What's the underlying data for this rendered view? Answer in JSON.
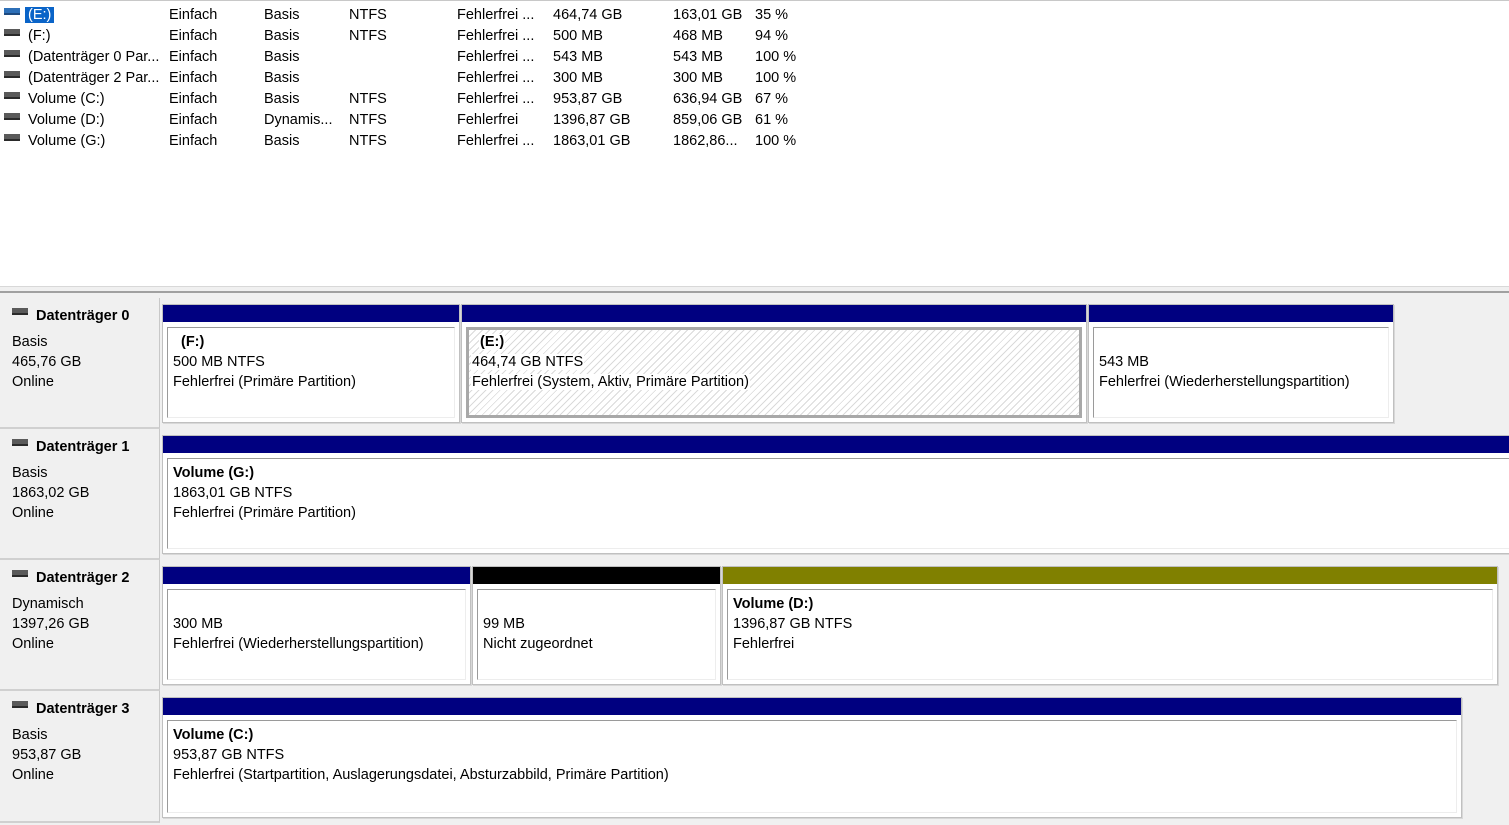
{
  "colors": {
    "primary_partition": "#000080",
    "unallocated": "#000000",
    "simple_dynamic_volume": "#808000",
    "selection": "#0a64c8"
  },
  "volumes": [
    {
      "name": "(E:)",
      "layout": "Einfach",
      "type": "Basis",
      "fs": "NTFS",
      "status": "Fehlerfrei ...",
      "capacity": "464,74 GB",
      "free": "163,01 GB",
      "pct": "35 %",
      "icon": "drive-icon",
      "selected": true
    },
    {
      "name": "(F:)",
      "layout": "Einfach",
      "type": "Basis",
      "fs": "NTFS",
      "status": "Fehlerfrei ...",
      "capacity": "500 MB",
      "free": "468 MB",
      "pct": "94 %",
      "icon": "drive-icon"
    },
    {
      "name": "(Datenträger 0 Par...",
      "layout": "Einfach",
      "type": "Basis",
      "fs": "",
      "status": "Fehlerfrei ...",
      "capacity": "543 MB",
      "free": "543 MB",
      "pct": "100 %",
      "icon": "drive-icon"
    },
    {
      "name": "(Datenträger 2 Par...",
      "layout": "Einfach",
      "type": "Basis",
      "fs": "",
      "status": "Fehlerfrei ...",
      "capacity": "300 MB",
      "free": "300 MB",
      "pct": "100 %",
      "icon": "drive-icon"
    },
    {
      "name": "Volume (C:)",
      "layout": "Einfach",
      "type": "Basis",
      "fs": "NTFS",
      "status": "Fehlerfrei ...",
      "capacity": "953,87 GB",
      "free": "636,94 GB",
      "pct": "67 %",
      "icon": "drive-icon"
    },
    {
      "name": "Volume (D:)",
      "layout": "Einfach",
      "type": "Dynamis...",
      "fs": "NTFS",
      "status": "Fehlerfrei",
      "capacity": "1396,87 GB",
      "free": "859,06 GB",
      "pct": "61 %",
      "icon": "drive-icon"
    },
    {
      "name": "Volume (G:)",
      "layout": "Einfach",
      "type": "Basis",
      "fs": "NTFS",
      "status": "Fehlerfrei ...",
      "capacity": "1863,01 GB",
      "free": "1862,86...",
      "pct": "100 %",
      "icon": "drive-icon"
    }
  ],
  "disks": [
    {
      "title": "Datenträger 0",
      "type": "Basis",
      "size": "465,76 GB",
      "state": "Online",
      "icon": "disk-icon",
      "partitions": [
        {
          "name": "(F:)",
          "size": "500 MB NTFS",
          "status": "Fehlerfrei (Primäre Partition)",
          "color": "#000080"
        },
        {
          "name": "(E:)",
          "size": "464,74 GB NTFS",
          "status": "Fehlerfrei (System, Aktiv, Primäre Partition)",
          "color": "#000080",
          "selected": true
        },
        {
          "name": "",
          "size": "543 MB",
          "status": "Fehlerfrei (Wiederherstellungspartition)",
          "color": "#000080"
        }
      ]
    },
    {
      "title": "Datenträger 1",
      "type": "Basis",
      "size": "1863,02 GB",
      "state": "Online",
      "icon": "disk-icon",
      "partitions": [
        {
          "name": "Volume  (G:)",
          "size": "1863,01 GB NTFS",
          "status": "Fehlerfrei (Primäre Partition)",
          "color": "#000080"
        }
      ]
    },
    {
      "title": "Datenträger 2",
      "type": "Dynamisch",
      "size": "1397,26 GB",
      "state": "Online",
      "icon": "disk-icon",
      "partitions": [
        {
          "name": "",
          "size": "300 MB",
          "status": "Fehlerfrei (Wiederherstellungspartition)",
          "color": "#000080"
        },
        {
          "name": "",
          "size": "99 MB",
          "status": "Nicht zugeordnet",
          "color": "#000000"
        },
        {
          "name": "Volume  (D:)",
          "size": "1396,87 GB NTFS",
          "status": "Fehlerfrei",
          "color": "#808000"
        }
      ]
    },
    {
      "title": "Datenträger 3",
      "type": "Basis",
      "size": "953,87 GB",
      "state": "Online",
      "icon": "disk-icon",
      "partitions": [
        {
          "name": "Volume  (C:)",
          "size": "953,87 GB NTFS",
          "status": "Fehlerfrei (Startpartition, Auslagerungsdatei, Absturzabbild, Primäre Partition)",
          "color": "#000080"
        }
      ]
    }
  ]
}
